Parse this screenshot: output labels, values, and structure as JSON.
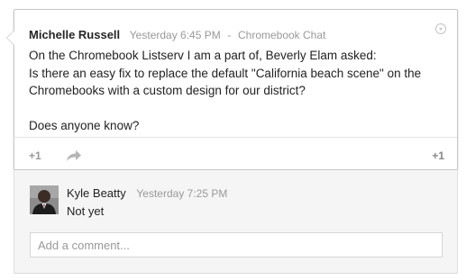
{
  "post": {
    "author": "Michelle Russell",
    "timestamp": "Yesterday 6:45 PM",
    "separator": "-",
    "community": "Chromebook Chat",
    "body": {
      "line1": "On the Chromebook Listserv I am a part of, Beverly Elam asked:",
      "line2": "Is there an easy fix to replace the default \"California beach scene\" on the Chromebooks with a custom design for our district?",
      "line3": "Does anyone know?"
    },
    "actions": {
      "plus_one_label": "+1",
      "plus_one_count": "+1",
      "share_icon": "share-arrow-icon"
    },
    "menu_icon": "dropdown-menu-icon"
  },
  "comments": [
    {
      "author": "Kyle Beatty",
      "timestamp": "Yesterday 7:25 PM",
      "text": "Not yet"
    }
  ],
  "comment_box": {
    "placeholder": "Add a comment..."
  },
  "colors": {
    "card_border": "#c8c8c8",
    "muted_text": "#999999",
    "comments_bg": "#f5f5f5"
  }
}
